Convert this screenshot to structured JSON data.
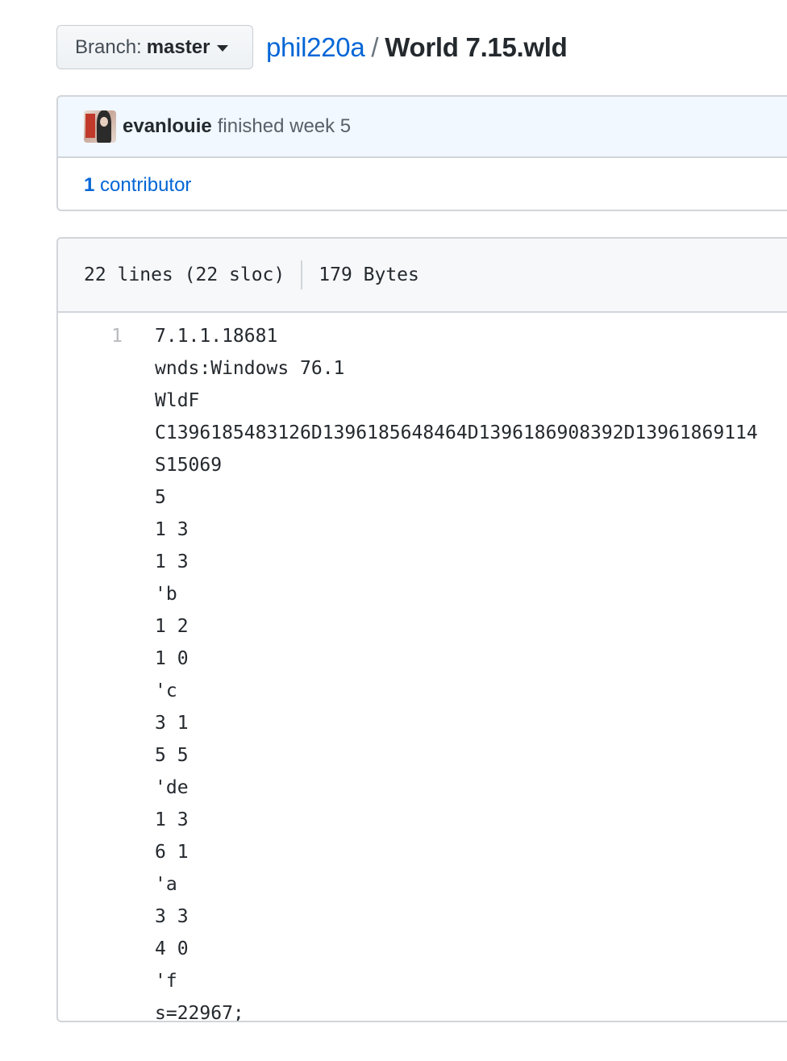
{
  "branch": {
    "label": "Branch:",
    "value": "master"
  },
  "breadcrumb": {
    "repo": "phil220a",
    "separator": "/",
    "file": "World 7.15.wld"
  },
  "commit": {
    "author": "evanlouie",
    "message": "finished week 5"
  },
  "contributors": {
    "count": "1",
    "label": "contributor"
  },
  "file_info": {
    "lines": "22 lines (22 sloc)",
    "size": "179 Bytes"
  },
  "code": {
    "first_line_number": "1",
    "lines": [
      "7.1.1.18681",
      "wnds:Windows 76.1",
      "WldF",
      "C1396185483126D1396185648464D1396186908392D13961869114",
      "S15069",
      "5",
      "1 3",
      "1 3",
      "'b",
      "1 2",
      "1 0",
      "'c",
      "3 1",
      "5 5",
      "'de",
      "1 3",
      "6 1",
      "'a",
      "3 3",
      "4 0",
      "'f",
      "s=22967;"
    ]
  }
}
